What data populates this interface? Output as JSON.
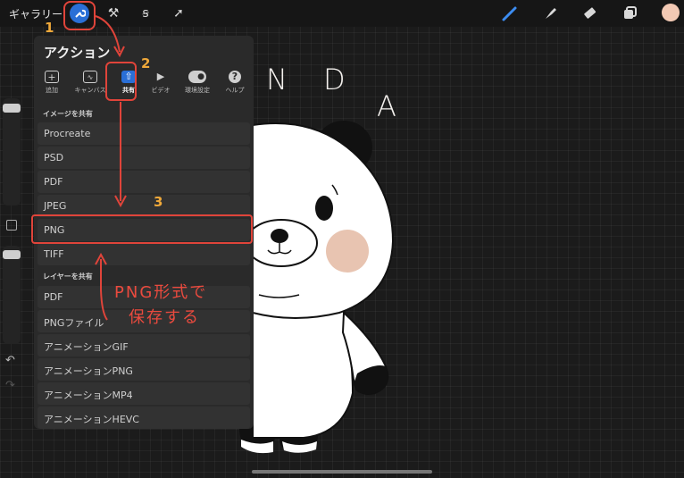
{
  "topbar": {
    "gallery_label": "ギャラリー",
    "tool_icons": [
      "wrench-icon",
      "magic-wand-icon",
      "selection-icon",
      "transform-arrow-icon"
    ],
    "right_icons": [
      "brush-icon",
      "smudge-icon",
      "eraser-icon",
      "layers-icon"
    ],
    "color_swatch": "#f2c9b4"
  },
  "panel": {
    "title": "アクション",
    "tabs": [
      {
        "label": "追加",
        "icon": "add-icon"
      },
      {
        "label": "キャンバス",
        "icon": "canvas-icon"
      },
      {
        "label": "共有",
        "icon": "share-icon"
      },
      {
        "label": "ビデオ",
        "icon": "video-icon"
      },
      {
        "label": "環境設定",
        "icon": "toggle-icon"
      },
      {
        "label": "ヘルプ",
        "icon": "help-icon"
      }
    ],
    "share_image_header": "イメージを共有",
    "share_image_items": [
      "Procreate",
      "PSD",
      "PDF",
      "JPEG",
      "PNG",
      "TIFF"
    ],
    "share_layers_header": "レイヤーを共有",
    "share_layers_items": [
      "PDF",
      "PNGファイル",
      "アニメーションGIF",
      "アニメーションPNG",
      "アニメーションMP4",
      "アニメーションHEVC"
    ]
  },
  "canvas": {
    "letters": [
      "N",
      "D",
      "A"
    ]
  },
  "annotations": {
    "step1": "1",
    "step2": "2",
    "step3": "3",
    "note_line1": "PNG形式で",
    "note_line2": "保存する",
    "color": "#e0443a"
  }
}
